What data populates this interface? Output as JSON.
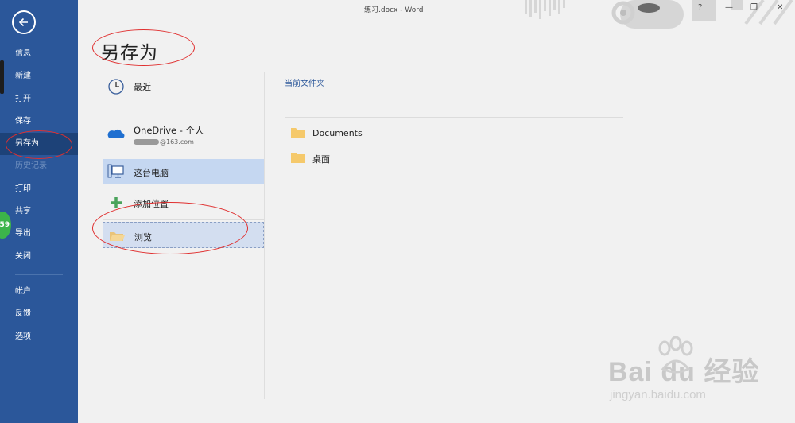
{
  "window": {
    "title": "练习.docx  -  Word",
    "help": "?",
    "minimize": "—",
    "restore": "❐",
    "close": "✕"
  },
  "sidebar": {
    "items": [
      {
        "label": "信息",
        "name": "info"
      },
      {
        "label": "新建",
        "name": "new"
      },
      {
        "label": "打开",
        "name": "open"
      },
      {
        "label": "保存",
        "name": "save"
      },
      {
        "label": "另存为",
        "name": "save-as",
        "active": true
      },
      {
        "label": "历史记录",
        "name": "history",
        "disabled": true
      },
      {
        "label": "打印",
        "name": "print"
      },
      {
        "label": "共享",
        "name": "share"
      },
      {
        "label": "导出",
        "name": "export"
      },
      {
        "label": "关闭",
        "name": "close"
      }
    ],
    "lower_items": [
      {
        "label": "帐户",
        "name": "account"
      },
      {
        "label": "反馈",
        "name": "feedback"
      },
      {
        "label": "选项",
        "name": "options"
      }
    ],
    "badge": "59"
  },
  "page": {
    "title": "另存为"
  },
  "places": {
    "recent": "最近",
    "onedrive": "OneDrive - 个人",
    "onedrive_account": "@163.com",
    "this_pc": "这台电脑",
    "add_place": "添加位置",
    "browse": "浏览"
  },
  "right_panel": {
    "current_folder_title": "当前文件夹",
    "folders": [
      "Documents",
      "桌面"
    ]
  },
  "watermark": {
    "brand": "Bai du 经验",
    "url": "jingyan.baidu.com"
  },
  "colors": {
    "sidebar": "#2b579a",
    "sidebar_active": "#1d4278",
    "selected_place": "#c5d7f1",
    "annotation": "#e03030",
    "folder": "#f5c96b"
  }
}
